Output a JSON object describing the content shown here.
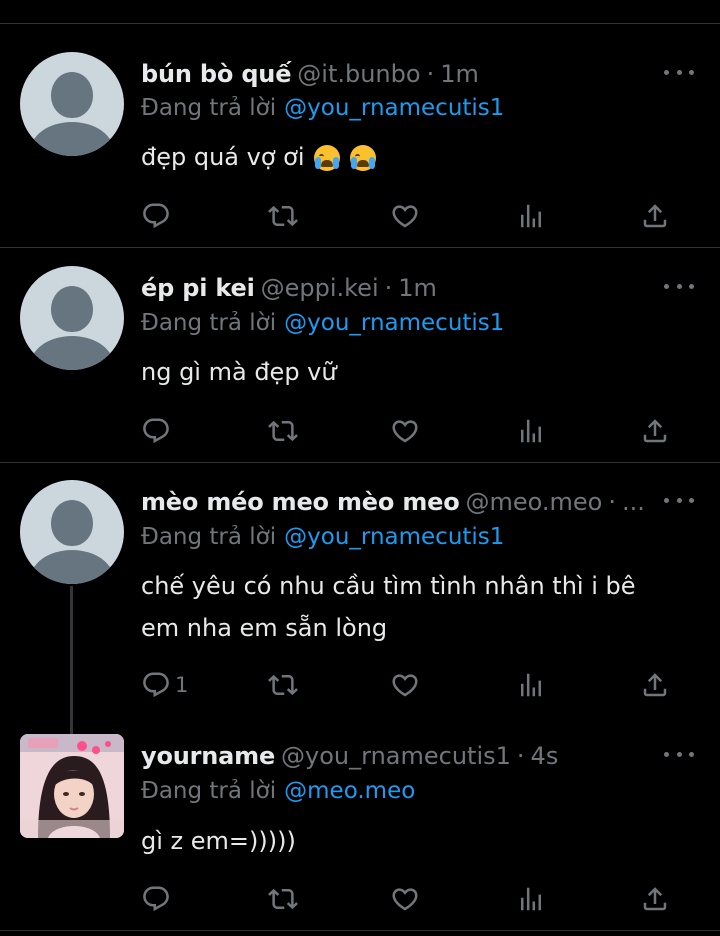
{
  "replying_to_label": "Đang trả lời",
  "tweets": [
    {
      "name": "bún bò quế",
      "handle": "@it.bunbo",
      "dot": "·",
      "time": "1m",
      "mention": "@you_rnamecutis1",
      "text": "đẹp quá vợ ơi",
      "emoji": "loudly-crying-face-emoji",
      "reply_count": ""
    },
    {
      "name": "ép pi kei",
      "handle": "@eppi.kei",
      "dot": "·",
      "time": "1m",
      "mention": "@you_rnamecutis1",
      "text": "ng gì mà đẹp vữ",
      "reply_count": ""
    },
    {
      "name": "mèo méo meo mèo meo",
      "handle": "@meo.meo",
      "dot": "·",
      "time": "...",
      "mention": "@you_rnamecutis1",
      "text_line1": "chế yêu có nhu cầu tìm tình nhân thì i bê",
      "text_line2": "em nha em sẵn lòng",
      "reply_count": "1"
    },
    {
      "name": "yourname",
      "handle": "@you_rnamecutis1",
      "dot": "·",
      "time": "4s",
      "mention": "@meo.meo",
      "text": "gì z em=)))))",
      "reply_count": ""
    }
  ],
  "icons": [
    "reply-icon",
    "retweet-icon",
    "like-icon",
    "views-icon",
    "share-icon",
    "more-icon"
  ],
  "colors": {
    "background": "#000000",
    "text": "#e7e9ea",
    "muted": "#71767b",
    "accent": "#1d9bf0",
    "divider": "#2f3336"
  }
}
